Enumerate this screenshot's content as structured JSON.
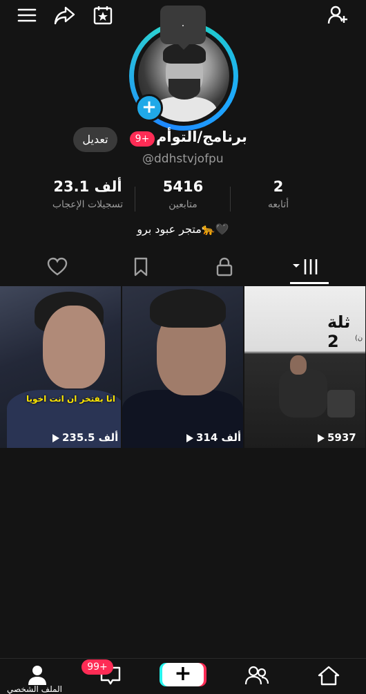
{
  "tooltip": {
    "text": "."
  },
  "profile": {
    "display_name": "برنامج/التوأم",
    "notification_badge": "9+",
    "handle": "@ddhstvjofpu",
    "edit_label": "تعديل",
    "bio": "متجر عبود برو🐆🖤"
  },
  "stats": [
    {
      "value": "23.1 ألف",
      "label": "تسجيلات الإعجاب"
    },
    {
      "value": "5416",
      "label": "متابعين"
    },
    {
      "value": "2",
      "label": "أتابعه"
    }
  ],
  "videos": [
    {
      "views": "235.5 ألف",
      "caption": "انا بفتخر ان انت اخويا"
    },
    {
      "views": "314 ألف"
    },
    {
      "views": "5937",
      "title": "ثلة 2",
      "subtitle": "(ن"
    }
  ],
  "bottom_nav": {
    "inbox_badge": "99+",
    "profile_label": "الملف الشخصي"
  },
  "icons": {
    "menu": "menu-icon",
    "share": "share-icon",
    "calendar": "calendar-star-icon",
    "add_user": "add-user-icon",
    "liked": "heart-icon",
    "favorites": "bookmark-icon",
    "private": "lock-icon",
    "videos": "grid-icon"
  },
  "colors": {
    "accent": "#fe2c55",
    "ring": "#20a9e8",
    "background": "#141414"
  }
}
